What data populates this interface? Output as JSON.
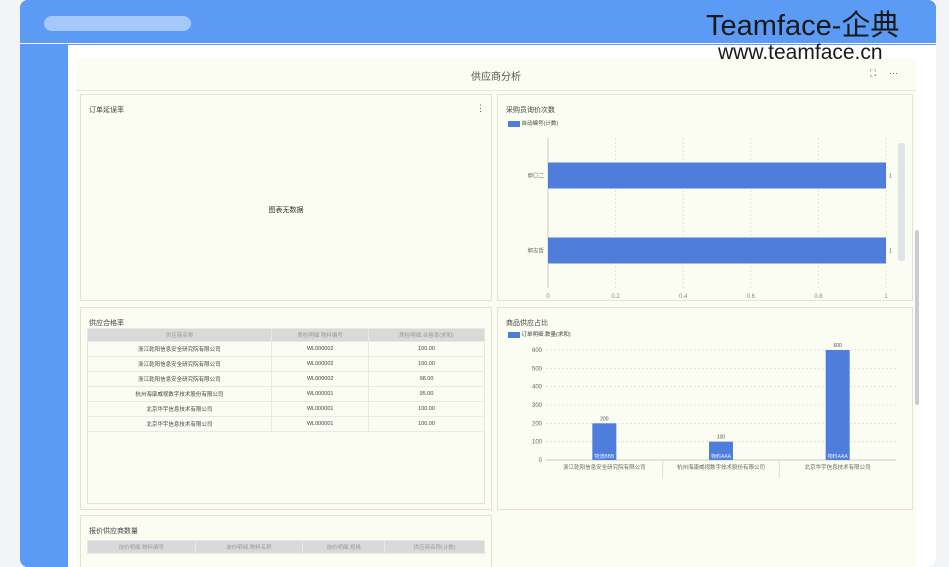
{
  "watermark": {
    "brand": "Teamface-企典",
    "url": "www.teamface.cn"
  },
  "dashboard": {
    "title": "供应商分析",
    "expand_icon": "expand-icon",
    "more_icon": "more-icon",
    "more_glyph": "···",
    "expand_glyph": "⛶"
  },
  "panel_delay": {
    "title": "订单延误率",
    "empty": "图表无数据",
    "menu_glyph": "⋮"
  },
  "panel_buyer": {
    "title": "采购员询价次数",
    "legend": "自动编号(计数)",
    "chart_data": {
      "type": "bar",
      "orientation": "horizontal",
      "categories": [
        "郭〇二",
        "郭志哲"
      ],
      "series": [
        {
          "name": "自动编号(计数)",
          "values": [
            1,
            1
          ]
        }
      ],
      "xlim": [
        0,
        1
      ],
      "xticks": [
        "0",
        "0.2",
        "0.4",
        "0.6",
        "0.8",
        "1"
      ],
      "data_labels": [
        "1",
        "1"
      ],
      "color": "#4f7ddc"
    }
  },
  "panel_pass": {
    "title": "供应合格率",
    "columns": [
      "供应商名称",
      "质检明细.物料编号",
      "质检明细.合格率(求和)"
    ],
    "rows": [
      [
        "浙江乾阳信息安全研究院有限公司",
        "WL000002",
        "100.00"
      ],
      [
        "浙江乾阳信息安全研究院有限公司",
        "WL000002",
        "100.00"
      ],
      [
        "浙江乾阳信息安全研究院有限公司",
        "WL000002",
        "98.00"
      ],
      [
        "杭州海康威视数字技术股份有限公司",
        "WL000001",
        "95.00"
      ],
      [
        "北京华宇信息技术有限公司",
        "WL000001",
        "100.00"
      ],
      [
        "北京华宇信息技术有限公司",
        "WL000001",
        "100.00"
      ]
    ]
  },
  "panel_share": {
    "title": "商品供应占比",
    "legend": "订单明细.数量(求和)",
    "chart_data": {
      "type": "bar",
      "categories": [
        "浙江乾阳信息安全研究院有限公司",
        "杭州海康威视数字技术股份有限公司",
        "北京华宇信息技术有限公司"
      ],
      "bar_labels": [
        "物流BBB",
        "物料AAA",
        "物料AAA"
      ],
      "series": [
        {
          "name": "订单明细.数量(求和)",
          "values": [
            200,
            100,
            600
          ]
        }
      ],
      "ylim": [
        0,
        600
      ],
      "yticks": [
        "0",
        "100",
        "200",
        "300",
        "400",
        "500",
        "600"
      ],
      "color": "#4f7ddc"
    }
  },
  "panel_quote": {
    "title": "报价供应商数量",
    "columns": [
      "询价明细.物料编号",
      "询价明细.物料名称",
      "询价明细.规格",
      "供应商名称(计数)"
    ]
  },
  "colors": {
    "frame": "#5b9bf6",
    "bar": "#4f7ddc",
    "panel_bg": "#fbfcf2"
  }
}
